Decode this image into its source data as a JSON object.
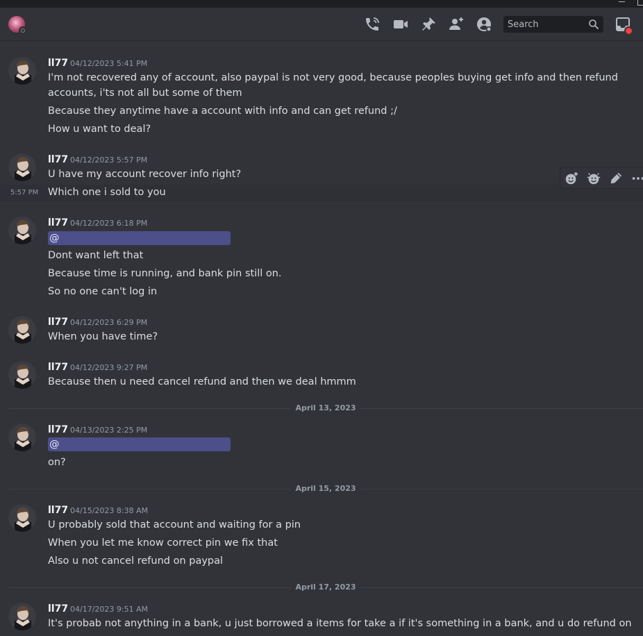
{
  "search": {
    "placeholder": "Search"
  },
  "header": {
    "icons": [
      "phone-call-icon",
      "video-call-icon",
      "pin-icon",
      "add-friend-icon",
      "user-profile-icon",
      "inbox-icon"
    ]
  },
  "toolbar": {
    "icons": [
      "add-reaction-icon",
      "super-reaction-icon",
      "edit-icon",
      "more-icon"
    ]
  },
  "colors": {
    "background": "#313338",
    "mention_bg": "#4c4f8a",
    "text": "#dbdee1",
    "muted": "#949ba4"
  },
  "dividers": [
    "April 13, 2023",
    "April 15, 2023",
    "April 17, 2023"
  ],
  "messages": [
    {
      "author": "ll77",
      "timestamp": "04/12/2023 5:41 PM",
      "lines": [
        "I'm not recovered any of account, also paypal is not very good, because peoples buying get info and then refund accounts, i'ts not all but some of them",
        "Because they anytime have a account with info and can get refund ;/",
        "How u want to deal?"
      ]
    },
    {
      "author": "ll77",
      "timestamp": "04/12/2023 5:57 PM",
      "hover_time": "5:57 PM",
      "lines": [
        "U have my account recover info right?",
        "Which one i sold to you"
      ]
    },
    {
      "author": "ll77",
      "timestamp": "04/12/2023 6:18 PM",
      "mention": "@",
      "lines": [
        "Dont want left that",
        "Because time is running, and bank pin still on.",
        "So no one can't log in"
      ]
    },
    {
      "author": "ll77",
      "timestamp": "04/12/2023 6:29 PM",
      "lines": [
        "When you have time?"
      ]
    },
    {
      "author": "ll77",
      "timestamp": "04/12/2023 9:27 PM",
      "lines": [
        "Because then u need cancel refund and then we deal hmmm"
      ]
    },
    {
      "author": "ll77",
      "timestamp": "04/13/2023 2:25 PM",
      "mention": "@",
      "lines": [
        "on?"
      ]
    },
    {
      "author": "ll77",
      "timestamp": "04/15/2023 8:38 AM",
      "lines": [
        "U probably sold that account and waiting for a pin",
        "When you let me know correct pin we fix that",
        "Also u not cancel refund on paypal"
      ]
    },
    {
      "author": "ll77",
      "timestamp": "04/17/2023 9:51 AM",
      "lines": [
        "It's probab not anything in a bank, u just borrowed a items for take a if it's something in a bank, and u do refund on paypal"
      ]
    }
  ]
}
